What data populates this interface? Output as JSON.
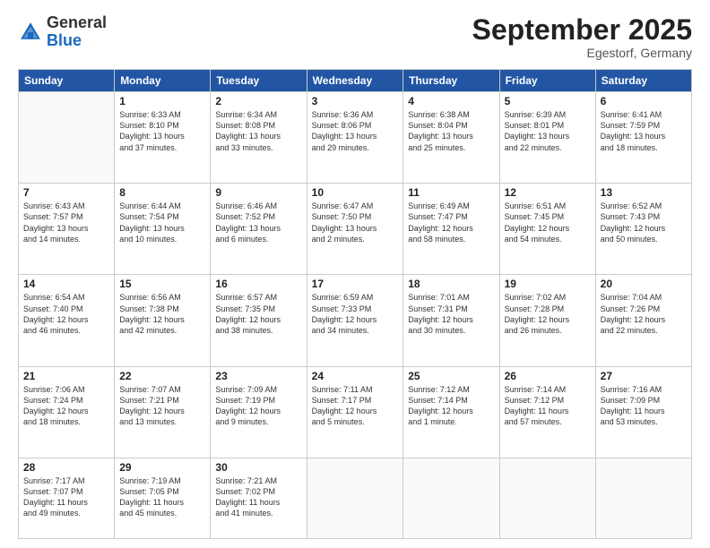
{
  "logo": {
    "general": "General",
    "blue": "Blue"
  },
  "title": "September 2025",
  "subtitle": "Egestorf, Germany",
  "days_of_week": [
    "Sunday",
    "Monday",
    "Tuesday",
    "Wednesday",
    "Thursday",
    "Friday",
    "Saturday"
  ],
  "weeks": [
    [
      {
        "day": "",
        "info": ""
      },
      {
        "day": "1",
        "info": "Sunrise: 6:33 AM\nSunset: 8:10 PM\nDaylight: 13 hours\nand 37 minutes."
      },
      {
        "day": "2",
        "info": "Sunrise: 6:34 AM\nSunset: 8:08 PM\nDaylight: 13 hours\nand 33 minutes."
      },
      {
        "day": "3",
        "info": "Sunrise: 6:36 AM\nSunset: 8:06 PM\nDaylight: 13 hours\nand 29 minutes."
      },
      {
        "day": "4",
        "info": "Sunrise: 6:38 AM\nSunset: 8:04 PM\nDaylight: 13 hours\nand 25 minutes."
      },
      {
        "day": "5",
        "info": "Sunrise: 6:39 AM\nSunset: 8:01 PM\nDaylight: 13 hours\nand 22 minutes."
      },
      {
        "day": "6",
        "info": "Sunrise: 6:41 AM\nSunset: 7:59 PM\nDaylight: 13 hours\nand 18 minutes."
      }
    ],
    [
      {
        "day": "7",
        "info": "Sunrise: 6:43 AM\nSunset: 7:57 PM\nDaylight: 13 hours\nand 14 minutes."
      },
      {
        "day": "8",
        "info": "Sunrise: 6:44 AM\nSunset: 7:54 PM\nDaylight: 13 hours\nand 10 minutes."
      },
      {
        "day": "9",
        "info": "Sunrise: 6:46 AM\nSunset: 7:52 PM\nDaylight: 13 hours\nand 6 minutes."
      },
      {
        "day": "10",
        "info": "Sunrise: 6:47 AM\nSunset: 7:50 PM\nDaylight: 13 hours\nand 2 minutes."
      },
      {
        "day": "11",
        "info": "Sunrise: 6:49 AM\nSunset: 7:47 PM\nDaylight: 12 hours\nand 58 minutes."
      },
      {
        "day": "12",
        "info": "Sunrise: 6:51 AM\nSunset: 7:45 PM\nDaylight: 12 hours\nand 54 minutes."
      },
      {
        "day": "13",
        "info": "Sunrise: 6:52 AM\nSunset: 7:43 PM\nDaylight: 12 hours\nand 50 minutes."
      }
    ],
    [
      {
        "day": "14",
        "info": "Sunrise: 6:54 AM\nSunset: 7:40 PM\nDaylight: 12 hours\nand 46 minutes."
      },
      {
        "day": "15",
        "info": "Sunrise: 6:56 AM\nSunset: 7:38 PM\nDaylight: 12 hours\nand 42 minutes."
      },
      {
        "day": "16",
        "info": "Sunrise: 6:57 AM\nSunset: 7:35 PM\nDaylight: 12 hours\nand 38 minutes."
      },
      {
        "day": "17",
        "info": "Sunrise: 6:59 AM\nSunset: 7:33 PM\nDaylight: 12 hours\nand 34 minutes."
      },
      {
        "day": "18",
        "info": "Sunrise: 7:01 AM\nSunset: 7:31 PM\nDaylight: 12 hours\nand 30 minutes."
      },
      {
        "day": "19",
        "info": "Sunrise: 7:02 AM\nSunset: 7:28 PM\nDaylight: 12 hours\nand 26 minutes."
      },
      {
        "day": "20",
        "info": "Sunrise: 7:04 AM\nSunset: 7:26 PM\nDaylight: 12 hours\nand 22 minutes."
      }
    ],
    [
      {
        "day": "21",
        "info": "Sunrise: 7:06 AM\nSunset: 7:24 PM\nDaylight: 12 hours\nand 18 minutes."
      },
      {
        "day": "22",
        "info": "Sunrise: 7:07 AM\nSunset: 7:21 PM\nDaylight: 12 hours\nand 13 minutes."
      },
      {
        "day": "23",
        "info": "Sunrise: 7:09 AM\nSunset: 7:19 PM\nDaylight: 12 hours\nand 9 minutes."
      },
      {
        "day": "24",
        "info": "Sunrise: 7:11 AM\nSunset: 7:17 PM\nDaylight: 12 hours\nand 5 minutes."
      },
      {
        "day": "25",
        "info": "Sunrise: 7:12 AM\nSunset: 7:14 PM\nDaylight: 12 hours\nand 1 minute."
      },
      {
        "day": "26",
        "info": "Sunrise: 7:14 AM\nSunset: 7:12 PM\nDaylight: 11 hours\nand 57 minutes."
      },
      {
        "day": "27",
        "info": "Sunrise: 7:16 AM\nSunset: 7:09 PM\nDaylight: 11 hours\nand 53 minutes."
      }
    ],
    [
      {
        "day": "28",
        "info": "Sunrise: 7:17 AM\nSunset: 7:07 PM\nDaylight: 11 hours\nand 49 minutes."
      },
      {
        "day": "29",
        "info": "Sunrise: 7:19 AM\nSunset: 7:05 PM\nDaylight: 11 hours\nand 45 minutes."
      },
      {
        "day": "30",
        "info": "Sunrise: 7:21 AM\nSunset: 7:02 PM\nDaylight: 11 hours\nand 41 minutes."
      },
      {
        "day": "",
        "info": ""
      },
      {
        "day": "",
        "info": ""
      },
      {
        "day": "",
        "info": ""
      },
      {
        "day": "",
        "info": ""
      }
    ]
  ]
}
